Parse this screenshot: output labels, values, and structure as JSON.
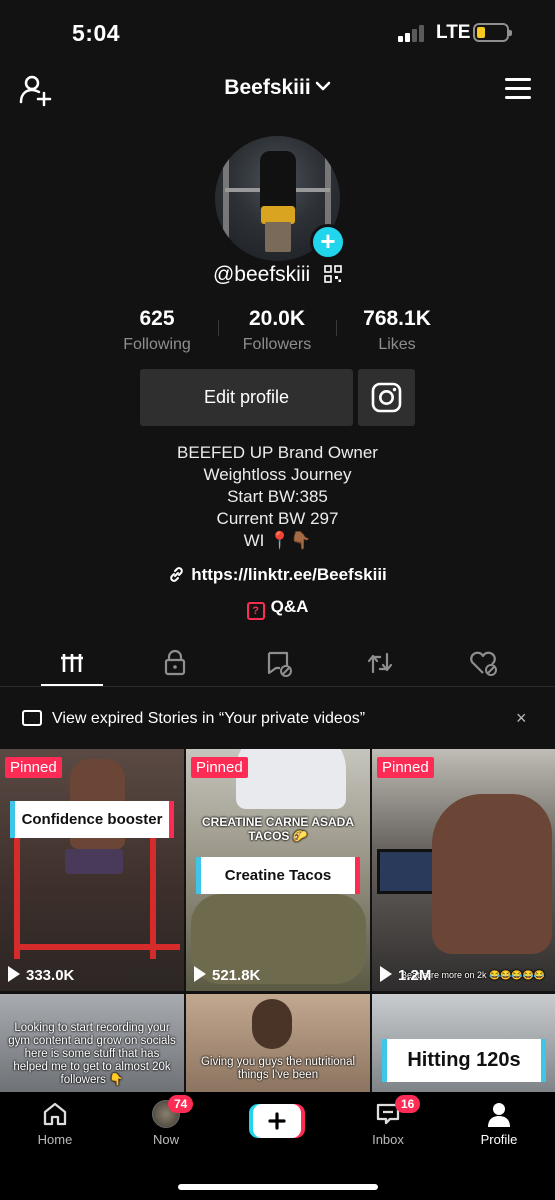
{
  "status": {
    "time": "5:04",
    "network": "LTE",
    "battery_color": "#f7c91e"
  },
  "topnav": {
    "username": "Beefskiii",
    "chevron": "⌄",
    "left_icon": "add-user-icon",
    "right_icon": "menu-icon"
  },
  "profile": {
    "handle": "@beefskiii",
    "stats": [
      {
        "value": "625",
        "label": "Following"
      },
      {
        "value": "20.0K",
        "label": "Followers"
      },
      {
        "value": "768.1K",
        "label": "Likes"
      }
    ],
    "edit_label": "Edit profile",
    "bio": [
      "BEEFED UP Brand Owner",
      "Weightloss Journey",
      "Start BW:385",
      "Current BW 297",
      "WI 📍👇🏾"
    ],
    "link": "https://linktr.ee/Beefskiii",
    "qa_label": "Q&A"
  },
  "banner": {
    "text": "View expired Stories in “Your private videos”",
    "close": "×"
  },
  "videos": [
    {
      "pinned": "Pinned",
      "caption": "Confidence booster",
      "views": "333.0K",
      "bg": "#4a3b35"
    },
    {
      "pinned": "Pinned",
      "top_text": "CREATINE CARNE ASADA TACOS 🌮",
      "caption": "Creatine Tacos",
      "views": "521.8K",
      "bg": "#8b8a7c"
    },
    {
      "pinned": "Pinned",
      "overlay": "Beat scre more on 2k 😂😂😂😂😂",
      "views": "1.2M",
      "bg": "#3d3a39"
    },
    {
      "overlay": "Looking to start recording your gym content and grow on socials here is some stuff that has helped me to get to almost 20k followers 👇",
      "bg": "#7b7d80"
    },
    {
      "overlay": "Giving you guys the nutritional things I've been",
      "bg": "#8a7a6a"
    },
    {
      "caption": "Hitting 120s",
      "bg": "#6d7478"
    }
  ],
  "bottomnav": {
    "items": [
      {
        "label": "Home"
      },
      {
        "label": "Now",
        "badge": "74"
      },
      {
        "label": ""
      },
      {
        "label": "Inbox",
        "badge": "16"
      },
      {
        "label": "Profile"
      }
    ]
  },
  "colors": {
    "accent_red": "#fe2c55",
    "accent_cyan": "#20d5ec",
    "background": "#121212"
  }
}
